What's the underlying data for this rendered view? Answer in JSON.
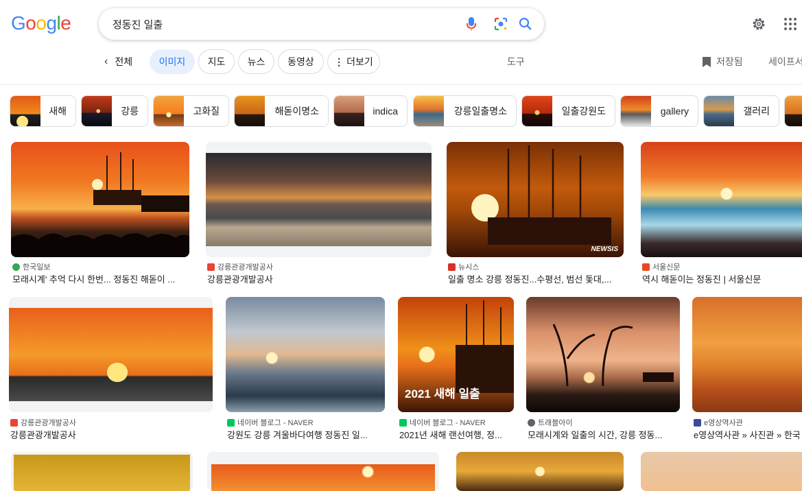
{
  "header": {
    "logo": [
      "G",
      "o",
      "o",
      "g",
      "l",
      "e"
    ],
    "logo_colors": [
      "#4285f4",
      "#ea4335",
      "#fbbc05",
      "#4285f4",
      "#34a853",
      "#ea4335"
    ],
    "query": "정동진 일출"
  },
  "tabs": {
    "back_label": "전체",
    "items": [
      "이미지",
      "지도",
      "뉴스",
      "동영상",
      "더보기"
    ],
    "more_prefix": "⋮",
    "tools": "도구",
    "saved": "저장됨",
    "safe_search": "세이프서치"
  },
  "chips": [
    "새해",
    "강릉",
    "고화질",
    "해돋이명소",
    "indica",
    "강릉일출명소",
    "일출강원도",
    "gallery",
    "갤러리"
  ],
  "results": [
    {
      "source": "한국일보",
      "title": "모래시계' 추억 다시 한번... 정동진 해돋이 ...",
      "fav_color": "#34a853"
    },
    {
      "source": "강릉관광개발공사",
      "title": "강릉관광개발공사",
      "fav_color": "#ea4335"
    },
    {
      "source": "뉴시스",
      "title": "일출 명소 강릉 정동진...수평선, 범선 돛대,...",
      "fav_color": "#d93025",
      "watermark": "NEWSIS"
    },
    {
      "source": "서울신문",
      "title": "역시 해돋이는 정동진 | 서울신문",
      "fav_color": "#e8491d"
    },
    {
      "source": "강릉관광개발공사",
      "title": "강릉관광개발공사",
      "fav_color": "#ea4335"
    },
    {
      "source": "네이버 블로그 - NAVER",
      "title": "강원도 강릉 겨울바다여행 정동진 일...",
      "fav_color": "#03c75a"
    },
    {
      "source": "네이버 블로그 - NAVER",
      "title": "2021년 새해 랜선여행, 정...",
      "fav_color": "#03c75a",
      "overlay": "2021 새해 일출"
    },
    {
      "source": "트래블아이",
      "title": "모래시계와 일출의 시간, 강릉 정동...",
      "fav_color": "#5f6368"
    },
    {
      "source": "e영상역사관",
      "title": "e영상역사관 » 사진관 » 한국",
      "fav_color": "#3c4b9e"
    }
  ]
}
